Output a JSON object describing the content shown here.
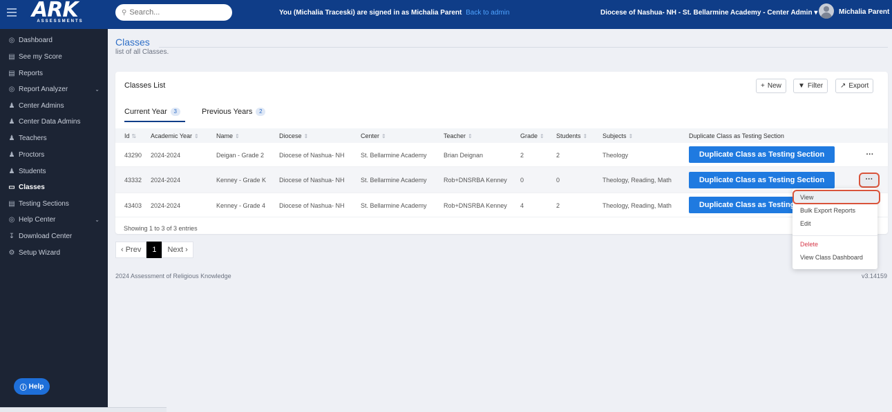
{
  "topbar": {
    "logo_main": "ARK",
    "logo_sub": "ASSESSMENTS",
    "search_placeholder": "Search...",
    "signed_in_text": "You (Michalia Traceski) are signed in as Michalia Parent",
    "back_link": "Back to admin",
    "context_select": "Diocese of Nashua- NH - St. Bellarmine Academy - Center Admin",
    "user_name": "Michalia Parent"
  },
  "sidebar": {
    "items": [
      {
        "label": "Dashboard",
        "icon": "dashboard-icon"
      },
      {
        "label": "See my Score",
        "icon": "score-icon"
      },
      {
        "label": "Reports",
        "icon": "reports-icon"
      },
      {
        "label": "Report Analyzer",
        "icon": "analyzer-icon"
      },
      {
        "label": "Center Admins",
        "icon": "admin-icon"
      },
      {
        "label": "Center Data Admins",
        "icon": "data-admin-icon"
      },
      {
        "label": "Teachers",
        "icon": "teacher-icon"
      },
      {
        "label": "Proctors",
        "icon": "proctor-icon"
      },
      {
        "label": "Students",
        "icon": "student-icon"
      },
      {
        "label": "Classes",
        "icon": "classes-icon"
      },
      {
        "label": "Testing Sections",
        "icon": "testing-icon"
      },
      {
        "label": "Help Center",
        "icon": "help-center-icon"
      },
      {
        "label": "Download Center",
        "icon": "download-icon"
      },
      {
        "label": "Setup Wizard",
        "icon": "setup-icon"
      }
    ],
    "help_label": "Help"
  },
  "page": {
    "title": "Classes",
    "subtitle": "list of all Classes."
  },
  "card": {
    "title": "Classes List",
    "new_label": "New",
    "filter_label": "Filter",
    "export_label": "Export",
    "tabs": [
      {
        "label": "Current Year",
        "count": "3"
      },
      {
        "label": "Previous Years",
        "count": "2"
      }
    ],
    "columns": [
      "Id",
      "Academic Year",
      "Name",
      "Diocese",
      "Center",
      "Teacher",
      "Grade",
      "Students",
      "Subjects",
      "Duplicate Class as Testing Section"
    ],
    "rows": [
      {
        "id": "43290",
        "year": "2024-2024",
        "name": "Deigan - Grade 2",
        "diocese": "Diocese of Nashua- NH",
        "center": "St. Bellarmine Academy",
        "teacher": "Brian Deignan",
        "grade": "2",
        "students": "2",
        "subjects": "Theology",
        "action": "Duplicate Class as Testing Section"
      },
      {
        "id": "43332",
        "year": "2024-2024",
        "name": "Kenney - Grade K",
        "diocese": "Diocese of Nashua- NH",
        "center": "St. Bellarmine Academy",
        "teacher": "Rob+DNSRBA Kenney",
        "grade": "0",
        "students": "0",
        "subjects": "Theology, Reading, Math",
        "action": "Duplicate Class as Testing Section"
      },
      {
        "id": "43403",
        "year": "2024-2024",
        "name": "Kenney - Grade 4",
        "diocese": "Diocese of Nashua- NH",
        "center": "St. Bellarmine Academy",
        "teacher": "Rob+DNSRBA Kenney",
        "grade": "4",
        "students": "2",
        "subjects": "Theology, Reading, Math",
        "action": "Duplicate Class as Testing Section"
      }
    ],
    "showing": "Showing 1 to 3 of 3 entries"
  },
  "pager": {
    "prev": "‹ Prev",
    "current": "1",
    "next": "Next ›"
  },
  "dropdown": {
    "items": [
      "View",
      "Bulk Export Reports",
      "Edit",
      "Delete",
      "View Class Dashboard"
    ]
  },
  "footer": {
    "left": "2024 Assessment of Religious Knowledge",
    "right": "v3.14159"
  }
}
